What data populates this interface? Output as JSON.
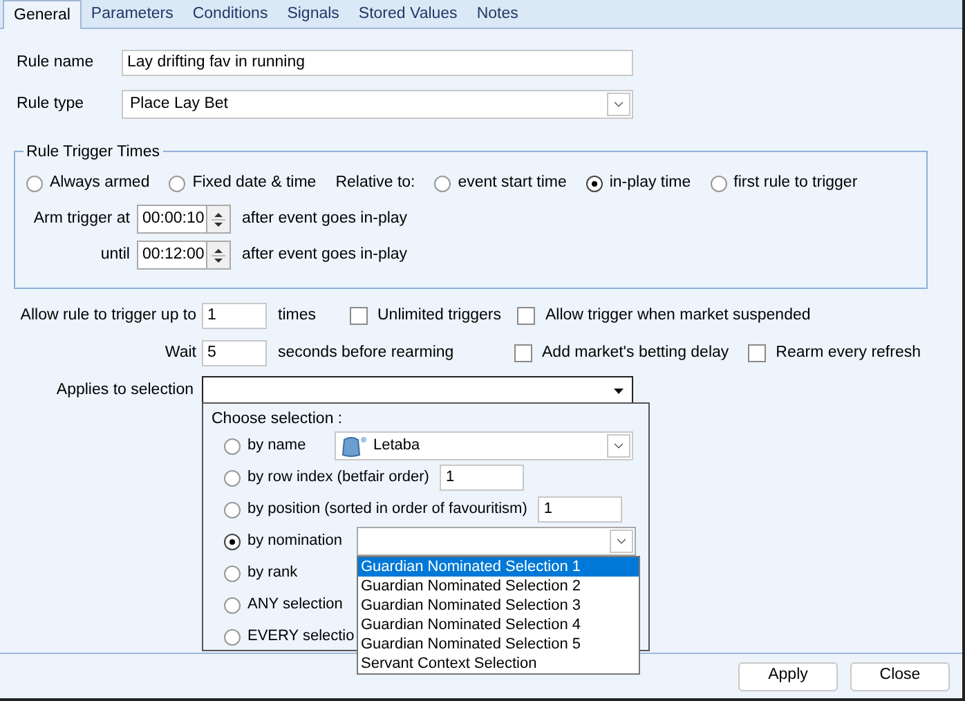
{
  "tabs": [
    {
      "label": "General",
      "selected": true
    },
    {
      "label": "Parameters",
      "selected": false
    },
    {
      "label": "Conditions",
      "selected": false
    },
    {
      "label": "Signals",
      "selected": false
    },
    {
      "label": "Stored Values",
      "selected": false
    },
    {
      "label": "Notes",
      "selected": false
    }
  ],
  "rule_name": {
    "label": "Rule name",
    "value": "Lay drifting fav in running"
  },
  "rule_type": {
    "label": "Rule type",
    "value": "Place Lay Bet"
  },
  "trigger_times": {
    "title": "Rule Trigger Times",
    "modes": [
      {
        "label": "Always armed",
        "selected": false
      },
      {
        "label": "Fixed date & time",
        "selected": false
      }
    ],
    "relative_label": "Relative to:",
    "relative_options": [
      {
        "label": "event start time",
        "selected": false
      },
      {
        "label": "in-play time",
        "selected": true
      },
      {
        "label": "first rule to trigger",
        "selected": false
      }
    ],
    "arm": {
      "label": "Arm trigger at",
      "value": "00:00:10",
      "suffix": "after event goes in-play"
    },
    "until": {
      "label": "until",
      "value": "00:12:00",
      "suffix": "after event goes in-play"
    }
  },
  "trigger_limit": {
    "label": "Allow rule to trigger up to",
    "value": "1",
    "suffix": "times"
  },
  "wait": {
    "label": "Wait",
    "value": "5",
    "suffix": "seconds before rearming"
  },
  "checkboxes_row_1": [
    {
      "label": "Unlimited triggers",
      "checked": false
    },
    {
      "label": "Allow trigger when market suspended",
      "checked": false
    }
  ],
  "checkboxes_row_2": [
    {
      "label": "Add market's betting delay",
      "checked": false
    },
    {
      "label": "Rearm every refresh",
      "checked": false
    }
  ],
  "applies_to": {
    "label": "Applies to selection",
    "expanded": true
  },
  "selection_popup": {
    "title": "Choose selection :",
    "options": [
      {
        "kind": "combo",
        "label": "by name",
        "selected": false,
        "value": "Letaba"
      },
      {
        "kind": "field",
        "label": "by row index (betfair order)",
        "selected": false,
        "value": "1"
      },
      {
        "kind": "field",
        "label": "by position (sorted in order of favouritism)",
        "selected": false,
        "value": "1"
      },
      {
        "kind": "list",
        "label": "by nomination",
        "selected": true,
        "items": [
          {
            "label": "Guardian Nominated Selection 1",
            "selected": true
          },
          {
            "label": "Guardian Nominated Selection 2",
            "selected": false
          },
          {
            "label": "Guardian Nominated Selection 3",
            "selected": false
          },
          {
            "label": "Guardian Nominated Selection 4",
            "selected": false
          },
          {
            "label": "Guardian Nominated Selection 5",
            "selected": false
          },
          {
            "label": "Servant Context Selection",
            "selected": false
          }
        ]
      },
      {
        "kind": "plain",
        "label": "by rank",
        "selected": false
      },
      {
        "kind": "plain",
        "label": "ANY selection",
        "selected": false
      },
      {
        "kind": "plain",
        "label": "EVERY selectio",
        "selected": false
      }
    ]
  },
  "buttons": [
    {
      "label": "Apply"
    },
    {
      "label": "Close"
    }
  ]
}
